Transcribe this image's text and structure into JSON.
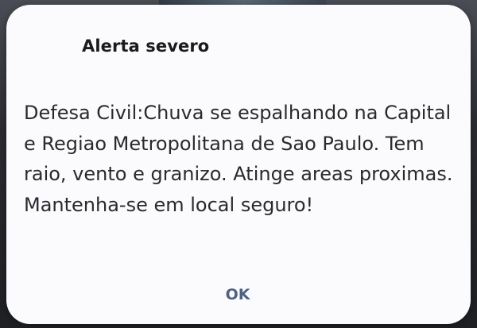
{
  "dialog": {
    "title": "Alerta severo",
    "message": "Defesa Civil:Chuva se espalhando na Capital e Regiao Metropolitana de Sao Paulo. Tem raio, vento e granizo. Atinge areas proximas. Mantenha-se em local seguro!",
    "ok_label": "OK"
  },
  "colors": {
    "dialog_background": "#fbfbfe",
    "title_text": "#1b1b1f",
    "body_text": "#2a2a2e",
    "button_text": "#4d6384"
  }
}
